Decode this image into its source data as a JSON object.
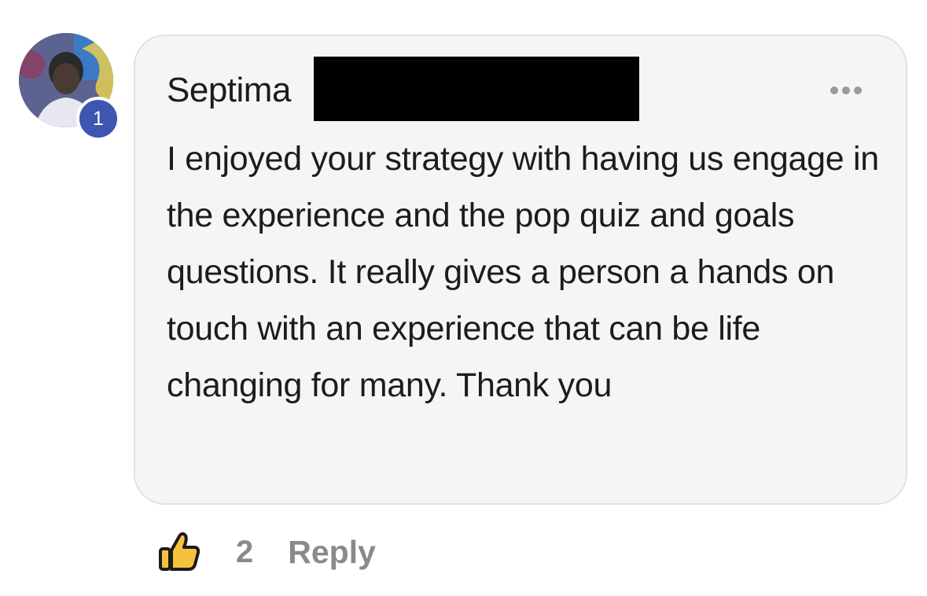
{
  "comment": {
    "author_name": "Septima",
    "avatar_badge": "1",
    "body": "I enjoyed your strategy with having us engage in the experience and the pop quiz and goals questions. It really gives a person a hands on touch with an experience that can be life changing for many. Thank you",
    "icons": {
      "menu": "more-options-icon",
      "like": "thumbs-up-icon"
    },
    "reactions": {
      "like_count": "2"
    },
    "actions": {
      "reply_label": "Reply"
    }
  },
  "colors": {
    "bubble_background": "#f6f5f4",
    "badge": "#3e55b2",
    "like_icon": "#f5c33b",
    "secondary_text": "#8a8a8a"
  }
}
